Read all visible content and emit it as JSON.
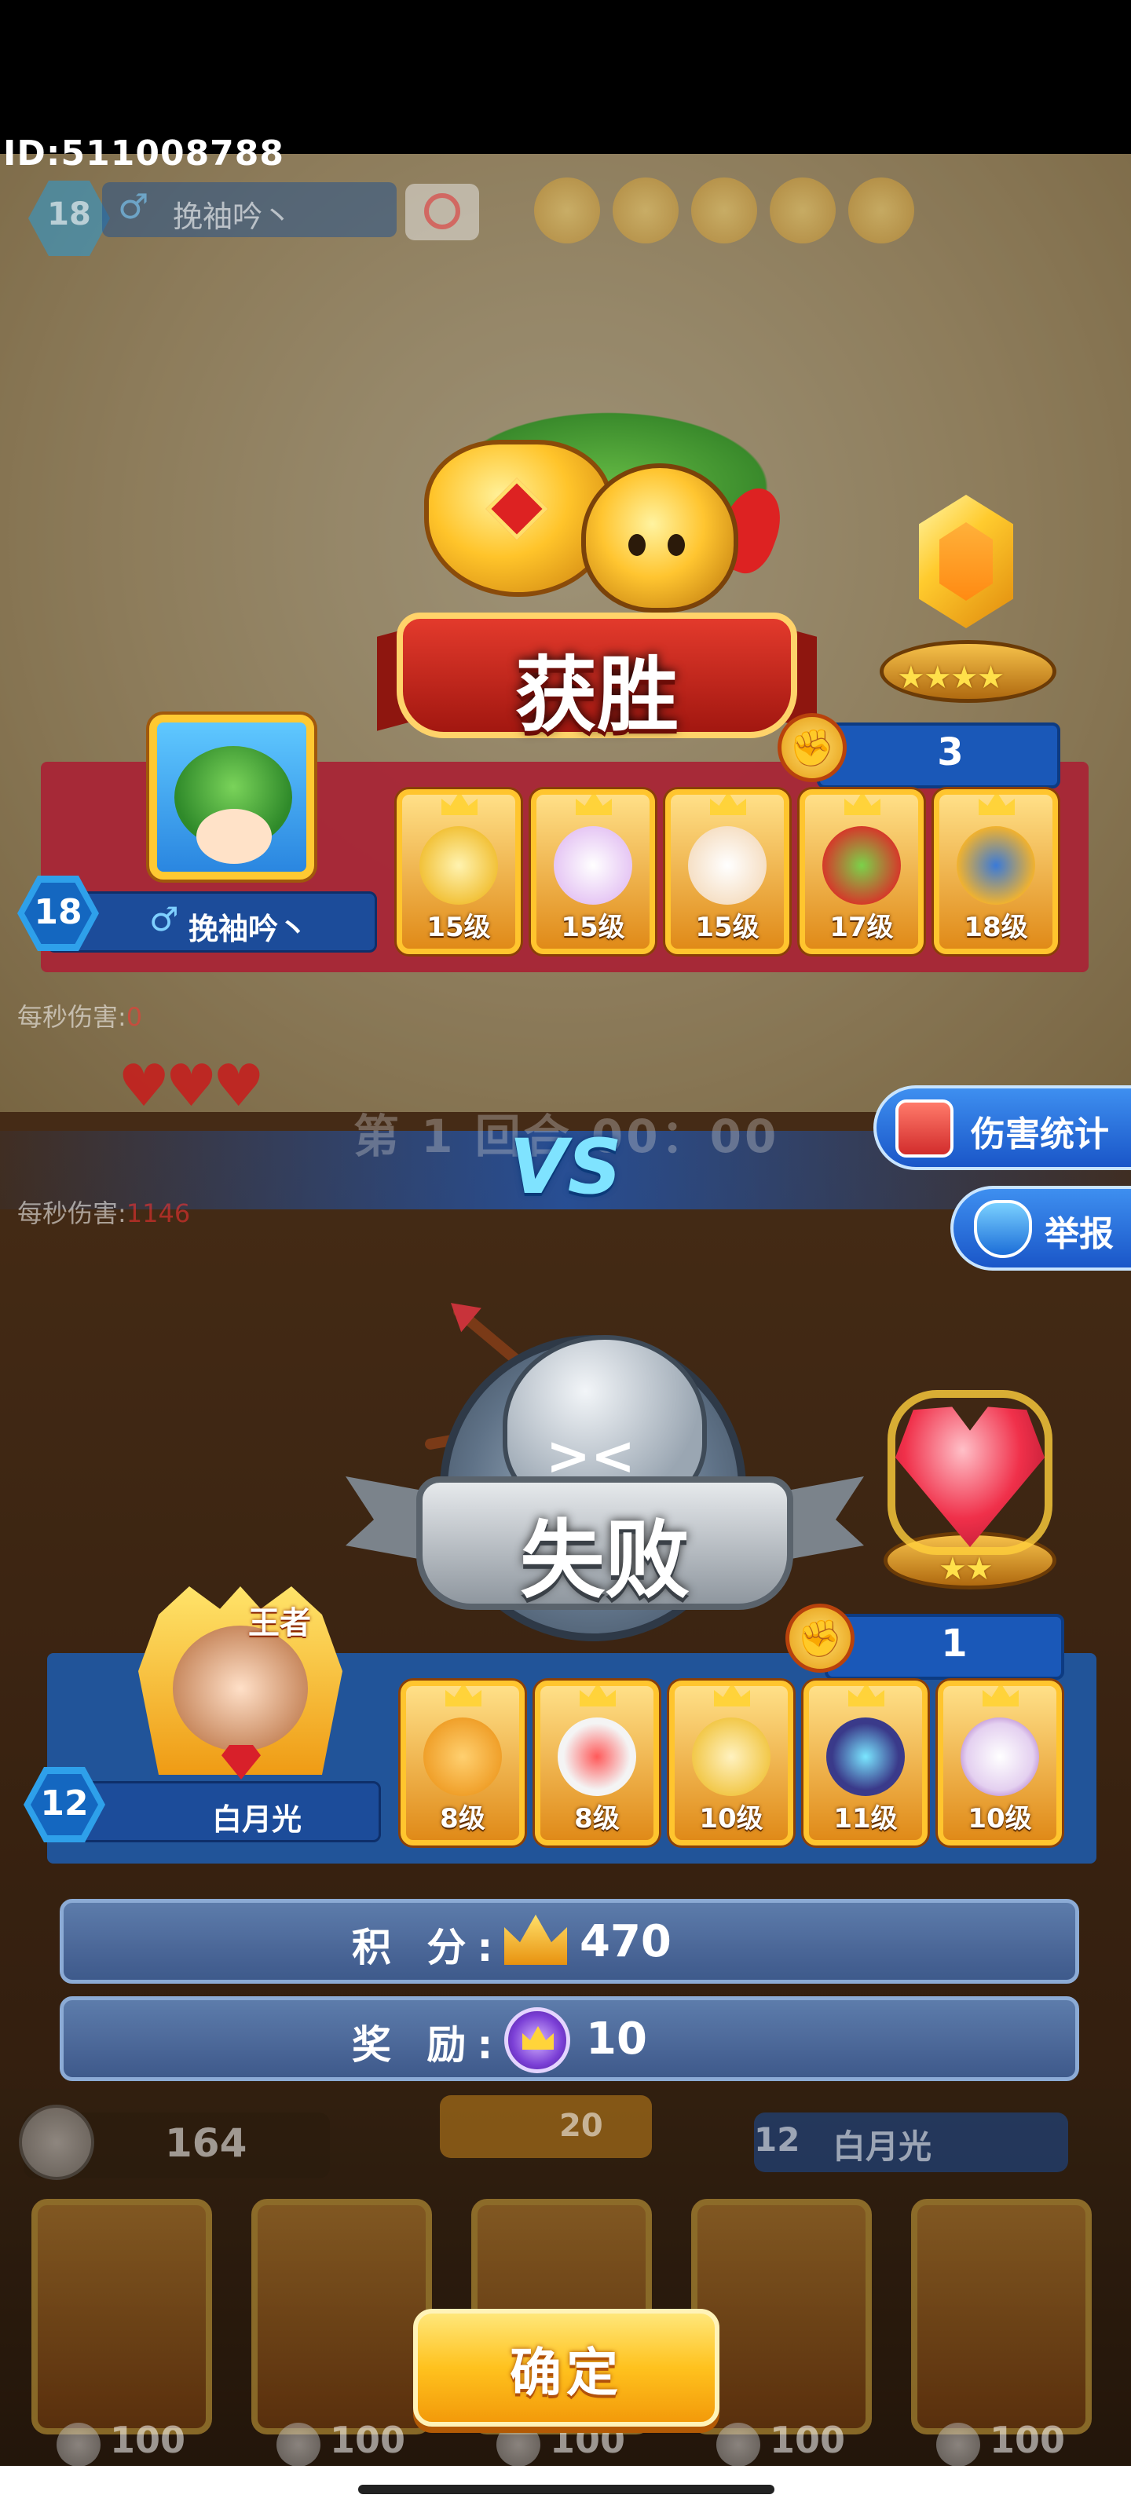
{
  "account": {
    "id_text": "ID:511008788"
  },
  "header": {
    "level": "18",
    "player_name": "挽袖吟丶"
  },
  "victory": {
    "banner_text": "获胜",
    "score": "3",
    "rank_stars": "★★★★",
    "player": {
      "level": "18",
      "gender_symbol": "♂",
      "name": "挽袖吟丶"
    },
    "heroes": [
      {
        "level": "15级",
        "color": "#f2c23a"
      },
      {
        "level": "15级",
        "color": "#e6c7f4"
      },
      {
        "level": "15级",
        "color": "#f6e0c6"
      },
      {
        "level": "17级",
        "color": "#d43a2a"
      },
      {
        "level": "18级",
        "color": "#f0b230"
      }
    ],
    "dps_label": "每秒伤害:",
    "dps_value": "0"
  },
  "battle": {
    "round_text": "第 1 回合 00：00",
    "vs_text": "VS",
    "hearts": "♥♥♥",
    "dps_label": "每秒伤害:",
    "dps_value": "1146",
    "buttons": {
      "damage_stats": "伤害统计",
      "report": "举报"
    }
  },
  "defeat": {
    "banner_text": "失败",
    "score": "1",
    "rank_stars": "★★",
    "player": {
      "level": "12",
      "name": "白月光",
      "king_tag": "王者"
    },
    "heroes": [
      {
        "level": "8级",
        "color": "#f0a02a"
      },
      {
        "level": "8级",
        "color": "#f4f4f4"
      },
      {
        "level": "10级",
        "color": "#f2c84a"
      },
      {
        "level": "11级",
        "color": "#3a3a8a"
      },
      {
        "level": "10级",
        "color": "#e4d0f0"
      }
    ]
  },
  "rewards": {
    "score_label": "积 分:",
    "score_value": "470",
    "reward_label": "奖 励:",
    "reward_value": "10"
  },
  "shop": {
    "coins": "164",
    "center_price": "20",
    "player_level": "12",
    "player_name": "白月光",
    "prices": [
      "100",
      "100",
      "100",
      "100",
      "100"
    ]
  },
  "confirm_button": "确定",
  "colors": {
    "victory_red": "#a82536",
    "defeat_blue": "#1f5aa8",
    "gold": "#ffc52e",
    "confirm": "#ffc21e"
  }
}
